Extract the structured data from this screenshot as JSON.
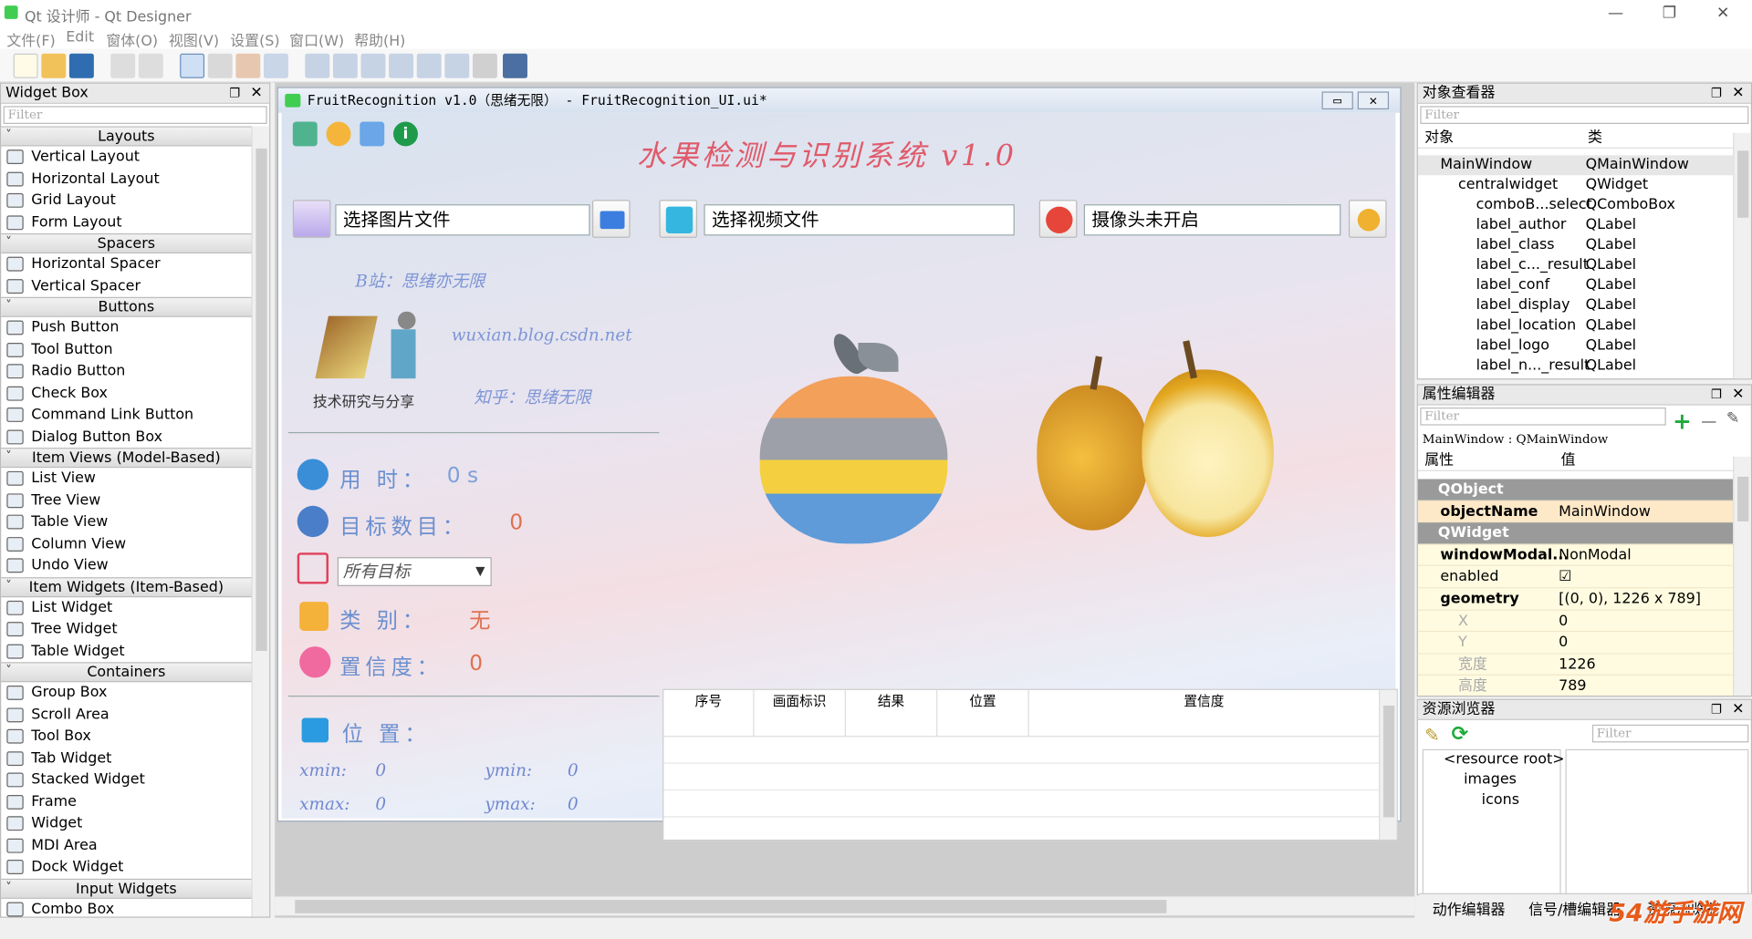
{
  "window": {
    "title": "Qt 设计师 - Qt Designer",
    "min": "—",
    "max": "❐",
    "close": "✕"
  },
  "menu": [
    "文件(F)",
    "Edit",
    "窗体(O)",
    "视图(V)",
    "设置(S)",
    "窗口(W)",
    "帮助(H)"
  ],
  "widget_box": {
    "title": "Widget Box",
    "filter": "Filter",
    "groups": [
      {
        "name": "Layouts",
        "items": [
          "Vertical Layout",
          "Horizontal Layout",
          "Grid Layout",
          "Form Layout"
        ]
      },
      {
        "name": "Spacers",
        "items": [
          "Horizontal Spacer",
          "Vertical Spacer"
        ]
      },
      {
        "name": "Buttons",
        "items": [
          "Push Button",
          "Tool Button",
          "Radio Button",
          "Check Box",
          "Command Link Button",
          "Dialog Button Box"
        ]
      },
      {
        "name": "Item Views (Model-Based)",
        "items": [
          "List View",
          "Tree View",
          "Table View",
          "Column View",
          "Undo View"
        ]
      },
      {
        "name": "Item Widgets (Item-Based)",
        "items": [
          "List Widget",
          "Tree Widget",
          "Table Widget"
        ]
      },
      {
        "name": "Containers",
        "items": [
          "Group Box",
          "Scroll Area",
          "Tool Box",
          "Tab Widget",
          "Stacked Widget",
          "Frame",
          "Widget",
          "MDI Area",
          "Dock Widget"
        ]
      },
      {
        "name": "Input Widgets",
        "items": [
          "Combo Box"
        ]
      }
    ]
  },
  "form": {
    "title": "FruitRecognition v1.0（思绪无限） - FruitRecognition_UI.ui*",
    "app_title": "水果检测与识别系统 v1.0",
    "image_placeholder": "选择图片文件",
    "video_placeholder": "选择视频文件",
    "camera_placeholder": "摄像头未开启",
    "bilibili": "B站：思绪亦无限",
    "blog": "wuxian.blog.csdn.net",
    "zhihu": "知乎：思绪无限",
    "logo_caption": "技术研究与分享",
    "time_label": "用 时：",
    "time_value": "0 s",
    "count_label": "目标数目：",
    "count_value": "0",
    "combo_value": "所有目标",
    "class_label": "类 别：",
    "class_value": "无",
    "conf_label": "置信度：",
    "conf_value": "0",
    "pos_label": "位 置：",
    "xmin_label": "xmin:",
    "xmin": "0",
    "ymin_label": "ymin:",
    "ymin": "0",
    "xmax_label": "xmax:",
    "xmax": "0",
    "ymax_label": "ymax:",
    "ymax": "0",
    "table_headers": [
      "序号",
      "画面标识",
      "结果",
      "位置",
      "置信度"
    ]
  },
  "object_inspector": {
    "title": "对象查看器",
    "filter": "Filter",
    "col_object": "对象",
    "col_class": "类",
    "rows": [
      {
        "obj": "MainWindow",
        "cls": "QMainWindow"
      },
      {
        "obj": "centralwidget",
        "cls": "QWidget"
      },
      {
        "obj": "comboB...select",
        "cls": "QComboBox"
      },
      {
        "obj": "label_author",
        "cls": "QLabel"
      },
      {
        "obj": "label_class",
        "cls": "QLabel"
      },
      {
        "obj": "label_c..._result",
        "cls": "QLabel"
      },
      {
        "obj": "label_conf",
        "cls": "QLabel"
      },
      {
        "obj": "label_display",
        "cls": "QLabel"
      },
      {
        "obj": "label_location",
        "cls": "QLabel"
      },
      {
        "obj": "label_logo",
        "cls": "QLabel"
      },
      {
        "obj": "label_n..._result",
        "cls": "QLabel"
      }
    ]
  },
  "property_editor": {
    "title": "属性编辑器",
    "filter": "Filter",
    "context": "MainWindow : QMainWindow",
    "col_prop": "属性",
    "col_value": "值",
    "rows": [
      {
        "p": "QObject",
        "v": "",
        "group": true
      },
      {
        "p": "objectName",
        "v": "MainWindow",
        "bold": true
      },
      {
        "p": "QWidget",
        "v": "",
        "group": true
      },
      {
        "p": "windowModal...",
        "v": "NonModal",
        "bold": true
      },
      {
        "p": "enabled",
        "v": "☑"
      },
      {
        "p": "geometry",
        "v": "[(0, 0), 1226 x 789]",
        "bold": true
      },
      {
        "p": "X",
        "v": "0",
        "sub": true
      },
      {
        "p": "Y",
        "v": "0",
        "sub": true
      },
      {
        "p": "宽度",
        "v": "1226",
        "sub": true
      },
      {
        "p": "高度",
        "v": "789",
        "sub": true
      }
    ]
  },
  "resource_browser": {
    "title": "资源浏览器",
    "filter": "Filter",
    "tree": [
      "<resource root>",
      "images",
      "icons"
    ]
  },
  "bottom_tabs": [
    "动作编辑器",
    "信号/槽编辑器",
    "资源浏览器"
  ],
  "watermark": "54游手游网"
}
